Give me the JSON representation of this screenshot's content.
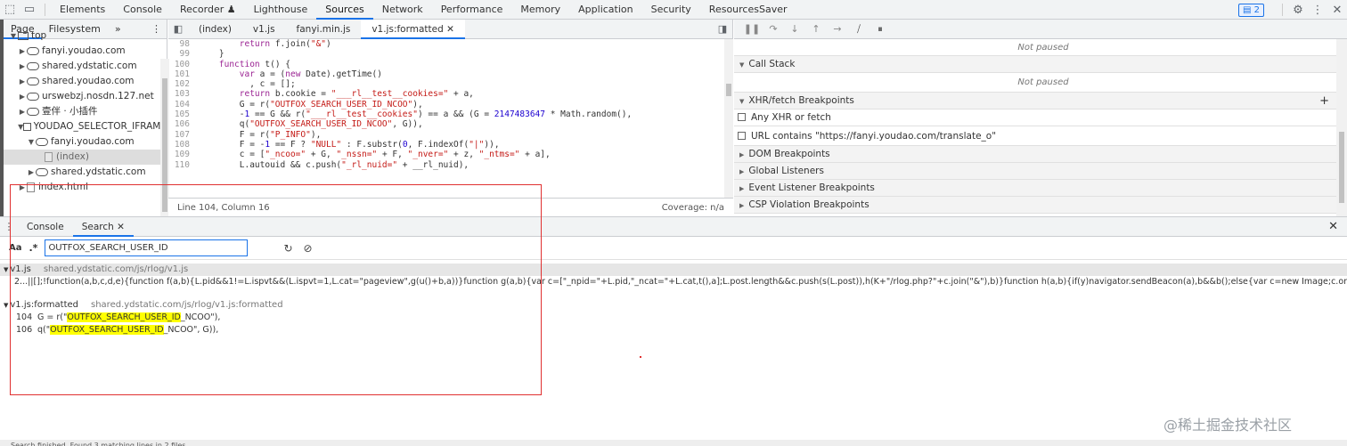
{
  "topbar": {
    "tabs": [
      "Elements",
      "Console",
      "Recorder ♟",
      "Lighthouse",
      "Sources",
      "Network",
      "Performance",
      "Memory",
      "Application",
      "Security",
      "ResourcesSaver"
    ],
    "active_tab": "Sources",
    "issues_count": "2"
  },
  "navigator": {
    "tabs": [
      "Page",
      "Filesystem"
    ],
    "more": "»",
    "tree": [
      {
        "label": "top",
        "indent": 0,
        "icon": "folder",
        "tri": "▼"
      },
      {
        "label": "fanyi.youdao.com",
        "indent": 1,
        "icon": "cloud",
        "tri": "▶"
      },
      {
        "label": "shared.ydstatic.com",
        "indent": 1,
        "icon": "cloud",
        "tri": "▶"
      },
      {
        "label": "shared.youdao.com",
        "indent": 1,
        "icon": "cloud",
        "tri": "▶"
      },
      {
        "label": "urswebzj.nosdn.127.net",
        "indent": 1,
        "icon": "cloud",
        "tri": "▶"
      },
      {
        "label": "壹伴 · 小插件",
        "indent": 1,
        "icon": "cloud",
        "tri": "▶"
      },
      {
        "label": "YOUDAO_SELECTOR_IFRAME",
        "indent": 1,
        "icon": "folder",
        "tri": "▼"
      },
      {
        "label": "fanyi.youdao.com",
        "indent": 2,
        "icon": "cloud",
        "tri": "▼"
      },
      {
        "label": "(index)",
        "indent": 3,
        "icon": "file-gray",
        "tri": "",
        "selected": true
      },
      {
        "label": "shared.ydstatic.com",
        "indent": 2,
        "icon": "cloud",
        "tri": "▶"
      },
      {
        "label": "index.html",
        "indent": 1,
        "icon": "file",
        "tri": "▶"
      }
    ]
  },
  "editor": {
    "tabs": [
      "(index)",
      "v1.js",
      "fanyi.min.js",
      "v1.js:formatted"
    ],
    "active_tab": "v1.js:formatted",
    "lines": [
      {
        "n": "98",
        "text": "        return f.join(\"&\")"
      },
      {
        "n": "99",
        "text": "    }"
      },
      {
        "n": "100",
        "text": "    function t() {"
      },
      {
        "n": "101",
        "text": "        var a = (new Date).getTime()"
      },
      {
        "n": "102",
        "text": "          , c = [];"
      },
      {
        "n": "103",
        "text": "        return b.cookie = \"___rl__test__cookies=\" + a,"
      },
      {
        "n": "104",
        "text": "        G = r(\"OUTFOX_SEARCH_USER_ID_NCOO\"),"
      },
      {
        "n": "105",
        "text": "        -1 == G && r(\"___rl__test__cookies\") == a && (G = 2147483647 * Math.random(),"
      },
      {
        "n": "106",
        "text": "        q(\"OUTFOX_SEARCH_USER_ID_NCOO\", G)),"
      },
      {
        "n": "107",
        "text": "        F = r(\"P_INFO\"),"
      },
      {
        "n": "108",
        "text": "        F = -1 == F ? \"NULL\" : F.substr(0, F.indexOf(\"|\")),"
      },
      {
        "n": "109",
        "text": "        c = [\"_ncoo=\" + G, \"_nssn=\" + F, \"_nver=\" + z, \"_ntms=\" + a],"
      },
      {
        "n": "110",
        "text": "        L.autouid && c.push(\"_rl_nuid=\" + __rl_nuid),"
      }
    ],
    "status_position": "Line 104, Column 16",
    "coverage": "Coverage: n/a"
  },
  "debugger": {
    "not_paused_1": "Not paused",
    "call_stack": "Call Stack",
    "not_paused_2": "Not paused",
    "xhr_breakpoints": "XHR/fetch Breakpoints",
    "any_xhr": "Any XHR or fetch",
    "url_contains": "URL contains \"https://fanyi.youdao.com/translate_o\"",
    "dom_breakpoints": "DOM Breakpoints",
    "global_listeners": "Global Listeners",
    "event_listener_breakpoints": "Event Listener Breakpoints",
    "csp_breakpoints": "CSP Violation Breakpoints"
  },
  "drawer": {
    "tabs": [
      "Console",
      "Search"
    ],
    "active_tab": "Search",
    "case_toggle": "Aa",
    "regex_toggle": ".*",
    "search_value": "OUTFOX_SEARCH_USER_ID",
    "results": [
      {
        "file": "v1.js",
        "path": "shared.ydstatic.com/js/rlog/v1.js",
        "lines": [
          {
            "n": "2",
            "before": "...||[];!function(a,b,c,d,e){function f(a,b){L.pid&&1!=L.ispvt&&(L.ispvt=1,L.cat=\"pageview\",g(u()+b,a))}function g(a,b){var c=[\"_npid=\"+L.pid,\"_ncat=\"+L.cat,t(),a];L.post.length&&c.push(s(L.post)),h(K+\"/rlog.php?\"+c.join(\"&\"),b)}function h(a,b){if(y)navigator.sendBeacon(a),b&&b();else{var c=new Image;c.onload=c.onerror=funct...",
            "match": "",
            "after": ""
          }
        ]
      },
      {
        "file": "v1.js:formatted",
        "path": "shared.ydstatic.com/js/rlog/v1.js:formatted",
        "lines": [
          {
            "n": "104",
            "before": "G = r(\"",
            "match": "OUTFOX_SEARCH_USER_ID",
            "after": "_NCOO\"),"
          },
          {
            "n": "106",
            "before": "q(\"",
            "match": "OUTFOX_SEARCH_USER_ID",
            "after": "_NCOO\", G)),"
          }
        ]
      }
    ],
    "bottom_status": "Search finished. Found 3 matching lines in 2 files."
  },
  "watermark": "@稀土掘金技术社区"
}
